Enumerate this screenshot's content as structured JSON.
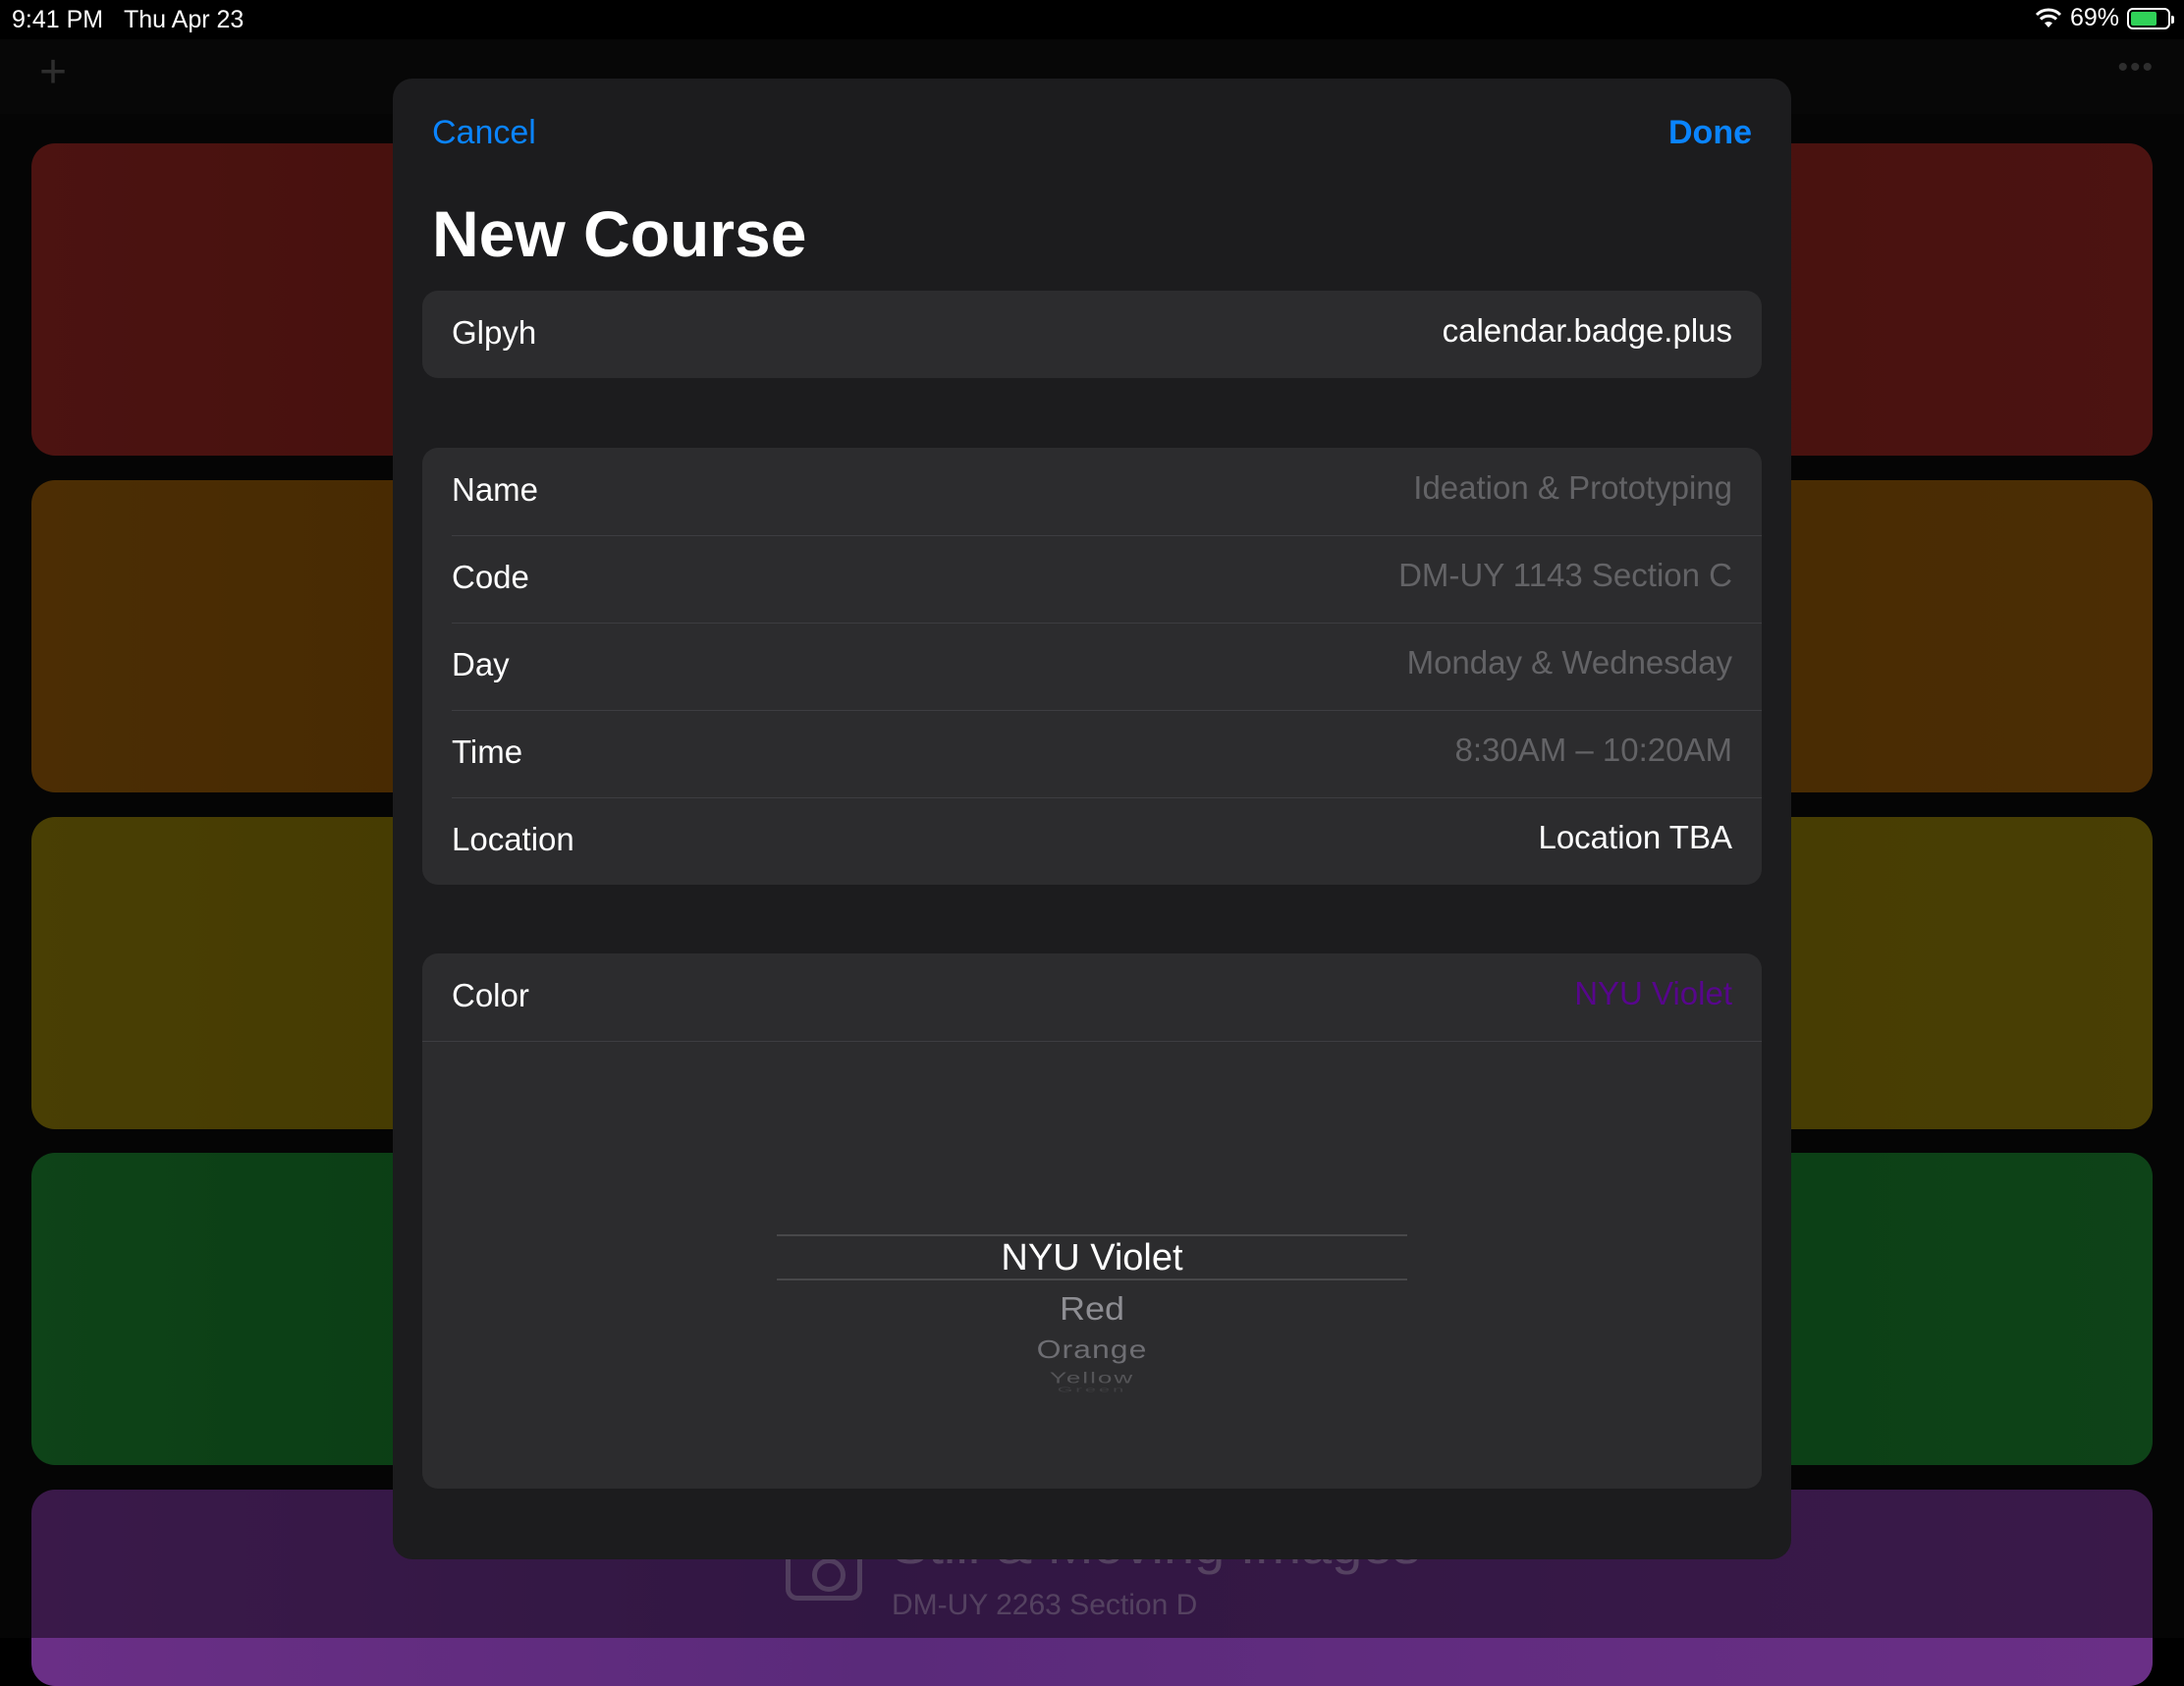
{
  "status_bar": {
    "time": "9:41 PM",
    "date": "Thu Apr 23",
    "battery_percent": "69%",
    "battery_level": 0.69,
    "battery_color": "#30d158"
  },
  "background_app": {
    "add_icon": "plus-icon",
    "more_icon": "ellipsis-icon",
    "course_card_colors": [
      "#8a2320",
      "#8a5309",
      "#857309",
      "#1a7a2c",
      "#6a2f86"
    ],
    "visible_course": {
      "title": "Still & Moving Images",
      "code": "DM-UY 2263 Section D",
      "icon": "camera-icon"
    }
  },
  "modal": {
    "cancel_label": "Cancel",
    "done_label": "Done",
    "accent_color": "#0a84ff",
    "title": "New Course",
    "glyph_row": {
      "label": "Glpyh",
      "value": "calendar.badge.plus"
    },
    "fields": [
      {
        "label": "Name",
        "placeholder": "Ideation & Prototyping"
      },
      {
        "label": "Code",
        "placeholder": "DM-UY 1143 Section C"
      },
      {
        "label": "Day",
        "placeholder": "Monday & Wednesday"
      },
      {
        "label": "Time",
        "placeholder": "8:30AM – 10:20AM"
      },
      {
        "label": "Location",
        "value": "Location TBA"
      }
    ],
    "color_row": {
      "label": "Color",
      "value": "NYU Violet",
      "value_color": "#57068c"
    },
    "color_picker": {
      "selected": "NYU Violet",
      "options_below": [
        "Red",
        "Orange",
        "Yellow",
        "Green"
      ]
    }
  }
}
